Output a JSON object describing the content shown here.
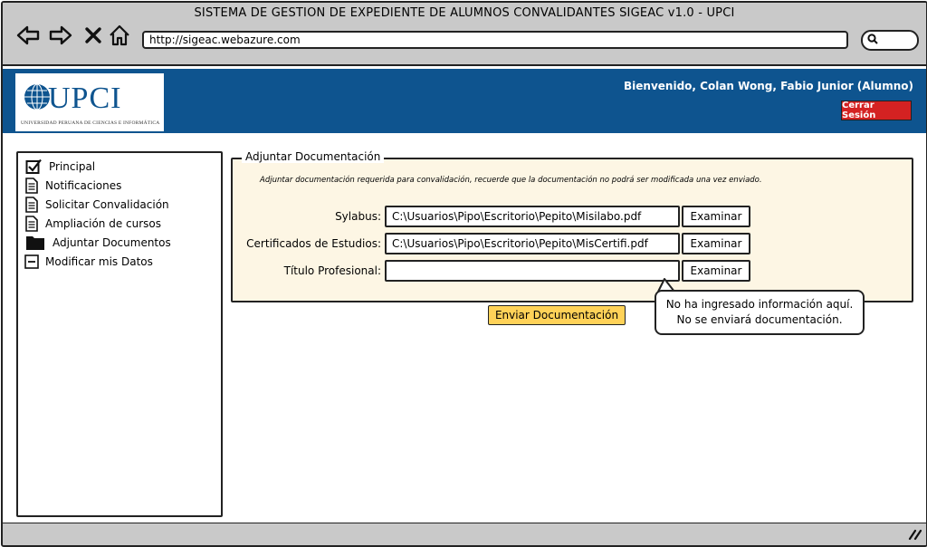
{
  "window": {
    "title": "SISTEMA DE GESTION DE EXPEDIENTE DE ALUMNOS CONVALIDANTES SIGEAC v1.0 - UPCI",
    "url": "http://sigeac.webazure.com",
    "nav_icons": [
      "back-arrow-icon",
      "forward-arrow-icon",
      "close-icon",
      "home-icon"
    ]
  },
  "header": {
    "logo_text": "UPCI",
    "logo_subtext": "UNIVERSIDAD PERUANA DE CIENCIAS E INFORMÁTICA",
    "welcome": "Bienvenido, Colan Wong, Fabio Junior  (Alumno)",
    "logout_label": "Cerrar Sesión",
    "colors": {
      "brand": "#0e548f",
      "logout": "#d42222"
    }
  },
  "sidebar": {
    "items": [
      {
        "label": "Principal",
        "icon": "checkbox-checked-icon"
      },
      {
        "label": "Notificaciones",
        "icon": "document-icon"
      },
      {
        "label": "Solicitar Convalidación",
        "icon": "document-icon"
      },
      {
        "label": "Ampliación de cursos",
        "icon": "document-icon"
      },
      {
        "label": "Adjuntar Documentos",
        "icon": "folder-icon"
      },
      {
        "label": "Modificar mis Datos",
        "icon": "minus-box-icon"
      }
    ]
  },
  "panel": {
    "legend": "Adjuntar Documentación",
    "hint": "Adjuntar documentación requerida para convalidación, recuerde que la documentación no podrá ser modificada una vez enviado.",
    "rows": [
      {
        "label": "Sylabus:",
        "value": "C:\\Usuarios\\Pipo\\Escritorio\\Pepito\\Misilabo.pdf",
        "button": "Examinar"
      },
      {
        "label": "Certificados de Estudios:",
        "value": "C:\\Usuarios\\Pipo\\Escritorio\\Pepito\\MisCertifi.pdf",
        "button": "Examinar"
      },
      {
        "label": "Título Profesional:",
        "value": "",
        "button": "Examinar"
      }
    ],
    "background": "#fdf6e4"
  },
  "send_button": {
    "label": "Enviar Documentación",
    "color": "#ffd258"
  },
  "tooltip": {
    "line1": "No ha ingresado información aquí.",
    "line2": "No se enviará documentación."
  }
}
